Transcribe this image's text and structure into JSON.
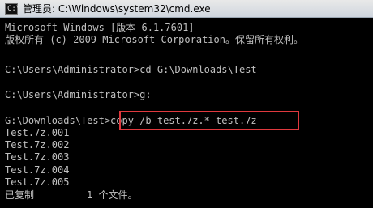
{
  "window": {
    "title": "管理员: C:\\Windows\\system32\\cmd.exe",
    "icon": "cmd-icon"
  },
  "console": {
    "lines": [
      "Microsoft Windows [版本 6.1.7601]",
      "版权所有 (c) 2009 Microsoft Corporation。保留所有权利。",
      "",
      "C:\\Users\\Administrator>cd G:\\Downloads\\Test",
      "",
      "C:\\Users\\Administrator>g:",
      "",
      "G:\\Downloads\\Test>copy /b test.7z.* test.7z",
      "Test.7z.001",
      "Test.7z.002",
      "Test.7z.003",
      "Test.7z.004",
      "Test.7z.005",
      "已复制         1 个文件。"
    ],
    "highlight_color": "#e0393e",
    "text_color": "#c0c0c0",
    "background_color": "#000000"
  }
}
